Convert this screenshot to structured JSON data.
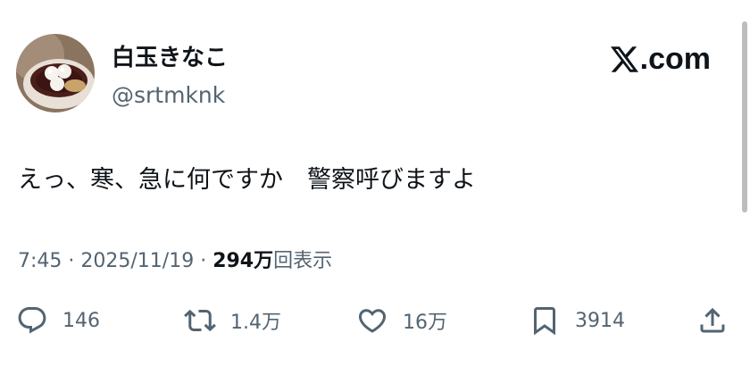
{
  "tweet": {
    "author": {
      "display_name": "白玉きなこ",
      "handle": "@srtmknk",
      "avatar_icon": "avatar-photo-shiratama"
    },
    "brand": {
      "text": ".com",
      "icon": "x-logo-icon"
    },
    "text": "えっ、寒、急に何ですか　警察呼びますよ",
    "meta": {
      "time": "7:45",
      "separator1": " · ",
      "date": "2025/11/19",
      "separator2": " · ",
      "views_count": "294万",
      "views_label": "回表示"
    },
    "actions": {
      "reply": {
        "icon": "reply-icon",
        "count": "146"
      },
      "retweet": {
        "icon": "retweet-icon",
        "count": "1.4万"
      },
      "like": {
        "icon": "like-heart-icon",
        "count": "16万"
      },
      "bookmark": {
        "icon": "bookmark-icon",
        "count": "3914"
      },
      "share": {
        "icon": "share-icon"
      }
    }
  },
  "colors": {
    "text_primary": "#0f1419",
    "text_secondary": "#536471",
    "background": "#ffffff"
  }
}
